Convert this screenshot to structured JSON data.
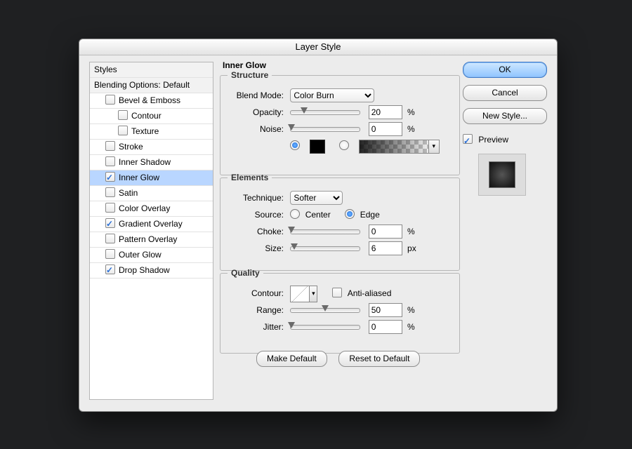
{
  "window": {
    "title": "Layer Style"
  },
  "styles_list": {
    "header": "Styles",
    "blending": "Blending Options: Default",
    "items": [
      {
        "label": "Bevel & Emboss",
        "checked": false,
        "indent": 1
      },
      {
        "label": "Contour",
        "checked": false,
        "indent": 2
      },
      {
        "label": "Texture",
        "checked": false,
        "indent": 2
      },
      {
        "label": "Stroke",
        "checked": false,
        "indent": 1
      },
      {
        "label": "Inner Shadow",
        "checked": false,
        "indent": 1
      },
      {
        "label": "Inner Glow",
        "checked": true,
        "indent": 1,
        "selected": true
      },
      {
        "label": "Satin",
        "checked": false,
        "indent": 1
      },
      {
        "label": "Color Overlay",
        "checked": false,
        "indent": 1
      },
      {
        "label": "Gradient Overlay",
        "checked": true,
        "indent": 1
      },
      {
        "label": "Pattern Overlay",
        "checked": false,
        "indent": 1
      },
      {
        "label": "Outer Glow",
        "checked": false,
        "indent": 1
      },
      {
        "label": "Drop Shadow",
        "checked": true,
        "indent": 1
      }
    ]
  },
  "panel": {
    "title": "Inner Glow",
    "structure": {
      "legend": "Structure",
      "blend_mode_label": "Blend Mode:",
      "blend_mode_value": "Color Burn",
      "opacity_label": "Opacity:",
      "opacity_value": "20",
      "opacity_unit": "%",
      "noise_label": "Noise:",
      "noise_value": "0",
      "noise_unit": "%",
      "color_selected": true,
      "color_hex": "#000000"
    },
    "elements": {
      "legend": "Elements",
      "technique_label": "Technique:",
      "technique_value": "Softer",
      "source_label": "Source:",
      "source_center": "Center",
      "source_edge": "Edge",
      "source_value": "Edge",
      "choke_label": "Choke:",
      "choke_value": "0",
      "choke_unit": "%",
      "size_label": "Size:",
      "size_value": "6",
      "size_unit": "px"
    },
    "quality": {
      "legend": "Quality",
      "contour_label": "Contour:",
      "aa_label": "Anti-aliased",
      "aa_checked": false,
      "range_label": "Range:",
      "range_value": "50",
      "range_unit": "%",
      "jitter_label": "Jitter:",
      "jitter_value": "0",
      "jitter_unit": "%"
    },
    "footer": {
      "make_default": "Make Default",
      "reset": "Reset to Default"
    }
  },
  "right": {
    "ok": "OK",
    "cancel": "Cancel",
    "new_style": "New Style...",
    "preview_label": "Preview",
    "preview_checked": true
  }
}
